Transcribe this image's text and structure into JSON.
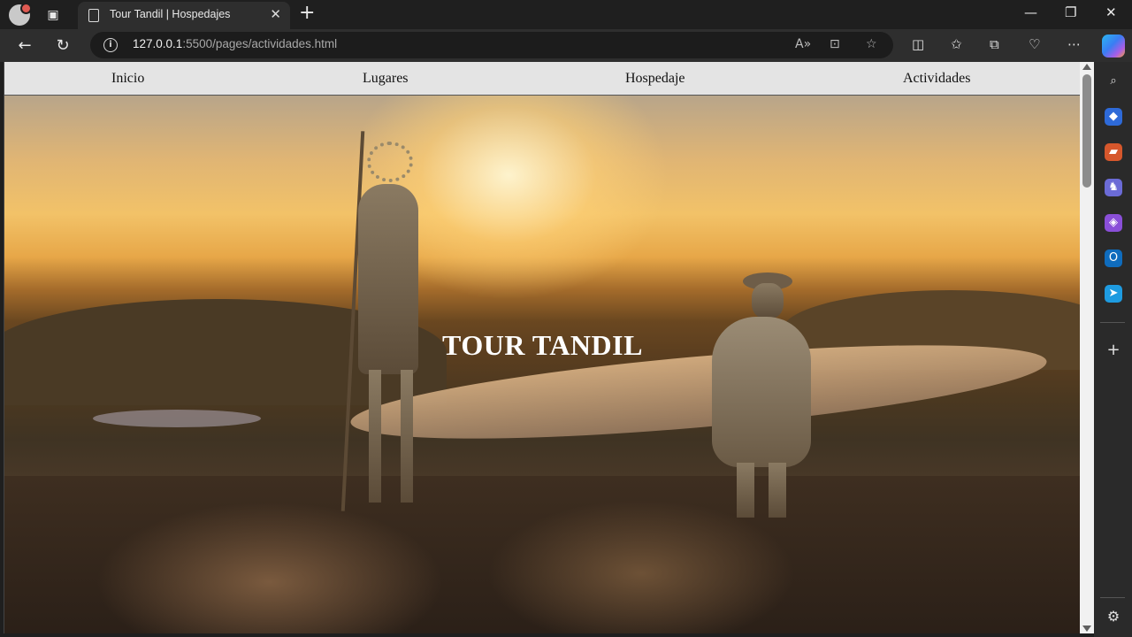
{
  "browser": {
    "tab_title": "Tour Tandil | Hospedajes",
    "url_host": "127.0.0.1",
    "url_path": ":5500/pages/actividades.html",
    "new_tab_glyph": "+",
    "close_glyph": "✕",
    "minimize_glyph": "—",
    "restore_glyph": "❐",
    "window_close_glyph": "✕"
  },
  "toolbar_icons": {
    "back": "←",
    "refresh": "↻",
    "read_aloud": "A»",
    "immersive": "⊡",
    "favorite": "☆",
    "split": "◫",
    "favorites": "✩",
    "collections": "⧉",
    "health": "♡",
    "more": "⋯"
  },
  "sidebar_icons": [
    {
      "name": "search-icon",
      "glyph": "⌕",
      "color": "#3a3a3a"
    },
    {
      "name": "tag-icon",
      "glyph": "◆",
      "color": "#2e6ad8"
    },
    {
      "name": "toolbox-icon",
      "glyph": "▰",
      "color": "#d6572c"
    },
    {
      "name": "chess-icon",
      "glyph": "♞",
      "color": "#6b6bd6"
    },
    {
      "name": "copilot-app-icon",
      "glyph": "◈",
      "color": "#8a4fd8"
    },
    {
      "name": "outlook-icon",
      "glyph": "O",
      "color": "#0f6cbd"
    },
    {
      "name": "send-icon",
      "glyph": "➤",
      "color": "#1e9be0"
    },
    {
      "name": "add-icon",
      "glyph": "+",
      "color": "#3a3a3a"
    },
    {
      "name": "settings-icon",
      "glyph": "⚙",
      "color": "#3a3a3a"
    }
  ],
  "page": {
    "nav": [
      "Inicio",
      "Lugares",
      "Hospedaje",
      "Actividades"
    ],
    "hero_title": "TOUR TANDIL"
  },
  "colors": {
    "navbar_bg": "#f5f5f5",
    "hero_title": "#ffffff",
    "browser_chrome": "#1f1f1f"
  }
}
